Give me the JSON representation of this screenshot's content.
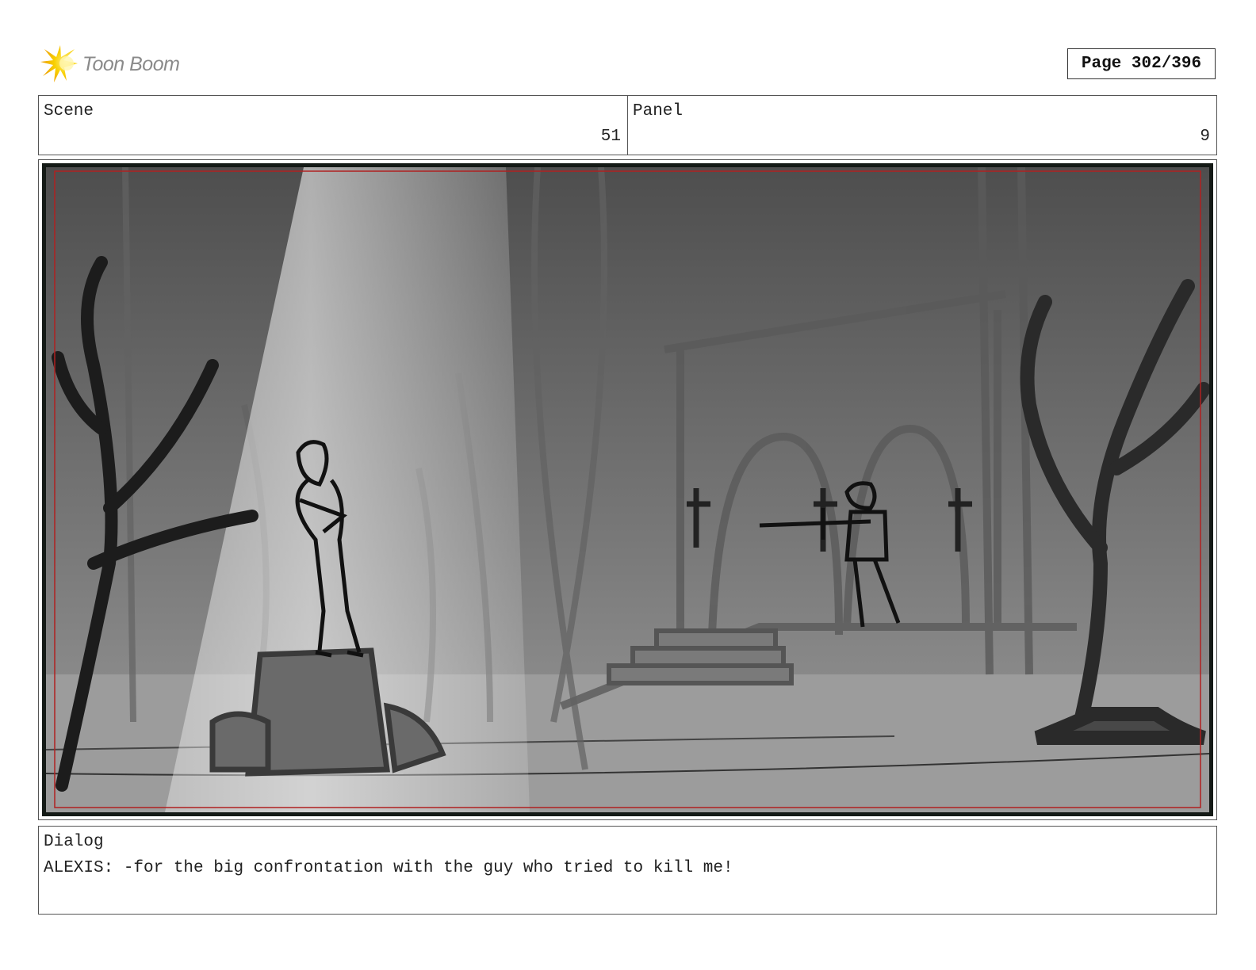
{
  "header": {
    "logo_text": "Toon Boom",
    "logo_icon": "starburst-icon",
    "page_label": "Page 302/396"
  },
  "info": {
    "scene_label": "Scene",
    "scene_value": "51",
    "panel_label": "Panel",
    "panel_value": "9"
  },
  "panel": {
    "image_kind": "storyboard-sketch"
  },
  "dialog": {
    "label": "Dialog",
    "text": "ALEXIS: -for the big confrontation with the guy who tried to kill me!"
  },
  "colors": {
    "logo_accent": "#f5c400",
    "logo_text": "#8a8a8a",
    "safe_frame": "#b02020"
  }
}
